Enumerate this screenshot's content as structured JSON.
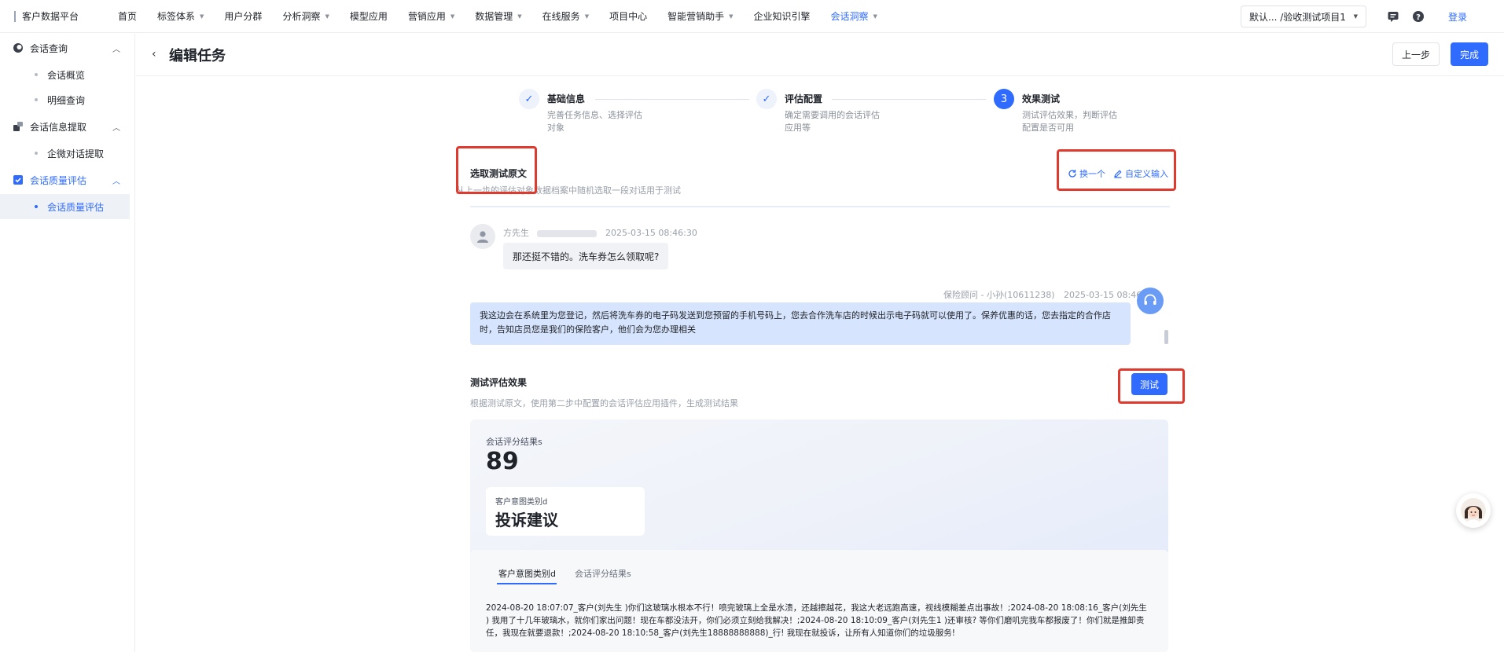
{
  "brand": {
    "name": "客户数据平台"
  },
  "nav": {
    "items": [
      {
        "label": "首页",
        "caret": false,
        "active": false
      },
      {
        "label": "标签体系",
        "caret": true,
        "active": false
      },
      {
        "label": "用户分群",
        "caret": false,
        "active": false
      },
      {
        "label": "分析洞察",
        "caret": true,
        "active": false
      },
      {
        "label": "模型应用",
        "caret": false,
        "active": false
      },
      {
        "label": "营销应用",
        "caret": true,
        "active": false
      },
      {
        "label": "数据管理",
        "caret": true,
        "active": false
      },
      {
        "label": "在线服务",
        "caret": true,
        "active": false
      },
      {
        "label": "项目中心",
        "caret": false,
        "active": false
      },
      {
        "label": "智能营销助手",
        "caret": true,
        "active": false
      },
      {
        "label": "企业知识引擎",
        "caret": false,
        "active": false
      },
      {
        "label": "会话洞察",
        "caret": true,
        "active": true
      }
    ],
    "project_selector": "默认...   /验收测试项目1",
    "login": "登录"
  },
  "sidebar": {
    "groups": [
      {
        "label": "会话查询",
        "icon": "chat-search-icon",
        "active": false,
        "items": [
          {
            "label": "会话概览",
            "active": false
          },
          {
            "label": "明细查询",
            "active": false
          }
        ]
      },
      {
        "label": "会话信息提取",
        "icon": "extract-icon",
        "active": false,
        "items": [
          {
            "label": "企微对话提取",
            "active": false
          }
        ]
      },
      {
        "label": "会话质量评估",
        "icon": "checkbox-icon",
        "active": true,
        "items": [
          {
            "label": "会话质量评估",
            "active": true
          }
        ]
      }
    ]
  },
  "header": {
    "title": "编辑任务",
    "prev_label": "上一步",
    "done_label": "完成"
  },
  "steps": [
    {
      "title": "基础信息",
      "desc": "完善任务信息、选择评估对象",
      "state": "done"
    },
    {
      "title": "评估配置",
      "desc": "确定需要调用的会话评估应用等",
      "state": "done"
    },
    {
      "title": "效果测试",
      "desc": "测试评估效果，判断评估配置是否可用",
      "state": "current",
      "number": "3"
    }
  ],
  "sample": {
    "title": "选取测试原文",
    "desc": "从上一步的评估对象数据档案中随机选取一段对话用于测试",
    "swap_label": "换一个",
    "custom_label": "自定义输入"
  },
  "chat": {
    "customer": {
      "name": "方先生",
      "time": "2025-03-15 08:46:30",
      "text": "那还挺不错的。洗车券怎么领取呢?"
    },
    "agent": {
      "name": "保险顾问 - 小孙(10611238)",
      "time": "2025-03-15 08:46:45",
      "text": "我这边会在系统里为您登记，然后将洗车券的电子码发送到您预留的手机号码上，您去合作洗车店的时候出示电子码就可以使用了。保养优惠的话，您去指定的合作店时，告知店员您是我们的保险客户，他们会为您办理相关"
    }
  },
  "test": {
    "title": "测试评估效果",
    "desc": "根据测试原文，使用第二步中配置的会话评估应用插件，生成测试结果",
    "button": "测试"
  },
  "result": {
    "score_label": "会话评分结果s",
    "score": "89",
    "intent_label": "客户意图类别d",
    "intent_value": "投诉建议",
    "tabs": [
      {
        "label": "客户意图类别d",
        "active": true
      },
      {
        "label": "会话评分结果s",
        "active": false
      }
    ],
    "text": "2024-08-20 18:07:07_客户(刘先生          )你们这玻璃水根本不行！喷完玻璃上全是水渍，还越擦越花，我这大老远跑高速，视线模糊差点出事故！;2024-08-20 18:08:16_客户(刘先生               ) 我用了十几年玻璃水，就你们家出问题！现在车都没法开，你们必须立刻给我解决！;2024-08-20 18:10:09_客户(刘先生1            )还审核? 等你们磨叽完我车都报废了！你们就是推卸责任，我现在就要退款！;2024-08-20 18:10:58_客户(刘先生18888888888)_行! 我现在就投诉，让所有人知道你们的垃圾服务!"
  },
  "colors": {
    "accent": "#2f6bff",
    "highlight_box": "#e03a2e",
    "agent_bubble": "#d7e4fd"
  }
}
